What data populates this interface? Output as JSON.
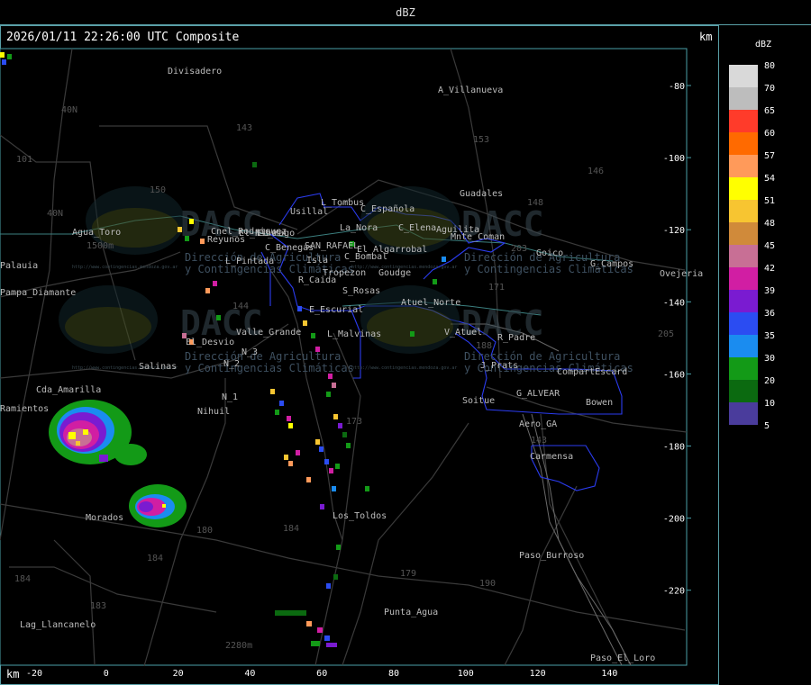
{
  "title": "dBZ",
  "header": "2026/01/11 22:26:00 UTC Composite",
  "unit_top": "km",
  "unit_bottom": "km",
  "legend": {
    "title": "dBZ",
    "colors": [
      "#d9d9d9",
      "#bdbdbd",
      "#ff3b2a",
      "#ff6a00",
      "#ff9a5a",
      "#ffff00",
      "#f7c531",
      "#d08a3a",
      "#c86f95",
      "#d11ea3",
      "#7a1bd1",
      "#2b4cf2",
      "#1a8cf0",
      "#139a17",
      "#0b6a10",
      "#4a3c9c"
    ],
    "labels": [
      "80",
      "70",
      "65",
      "60",
      "57",
      "54",
      "51",
      "48",
      "45",
      "42",
      "39",
      "36",
      "35",
      "30",
      "20",
      "10",
      "5"
    ]
  },
  "x_axis_labels": [
    "-20",
    "0",
    "20",
    "40",
    "60",
    "80",
    "100",
    "120",
    "140"
  ],
  "y_axis_labels": [
    "-80",
    "-100",
    "-120",
    "-140",
    "-160",
    "-180",
    "-200",
    "-220"
  ],
  "watermark": {
    "brand": "DACC",
    "line1": "Dirección de Agricultura",
    "line2": "y Contingencias Climáticas",
    "url": "http://www.contingencias.mendoza.gov.ar"
  },
  "places": [
    "Divisadero",
    "A_Villanueva",
    "Usillal",
    "L_Tombus",
    "C_Española",
    "La_Nora",
    "C_Elena",
    "Aguilita",
    "Agua_Toro",
    "Cnel_Rodriguez",
    "Reyunos",
    "El_Nihuil",
    "El_Mago",
    "SAN_RAFAEL",
    "El_Algarrobal",
    "C_Benegas",
    "C_Bombal",
    "Isla",
    "L_Pintada",
    "Tropezon",
    "Goudge",
    "R_Caida",
    "S_Rosas",
    "Atuel_Norte",
    "E_Escurial",
    "El_Desvio",
    "Valle_Grande",
    "L_Malvinas",
    "V_Atuel",
    "R_Padre",
    "Salinas",
    "N_2",
    "N_3",
    "N_1",
    "Nihuil",
    "J_Prats",
    "CompartEscard",
    "G_ALVEAR",
    "Bowen",
    "Cda_Amarilla",
    "Soitue",
    "Aero_GA",
    "Carmensa",
    "Morados",
    "Los_Toldos",
    "Paso_Burroso",
    "Lag_Llancanelo",
    "Punta_Agua",
    "Paso_El_Loro",
    "Guadales",
    "Goico",
    "G_Campos",
    "Ovejeria",
    "Pampa_Diamante",
    "Mnte_Coman",
    "Ramientos",
    "Palauia"
  ],
  "route_labels": [
    "143",
    "153",
    "146",
    "148",
    "150",
    "101",
    "40N",
    "40N",
    "144",
    "173",
    "171",
    "184",
    "180",
    "184",
    "179",
    "190",
    "183",
    "184",
    "205",
    "203",
    "188",
    "143",
    "2280m",
    "1500m"
  ]
}
